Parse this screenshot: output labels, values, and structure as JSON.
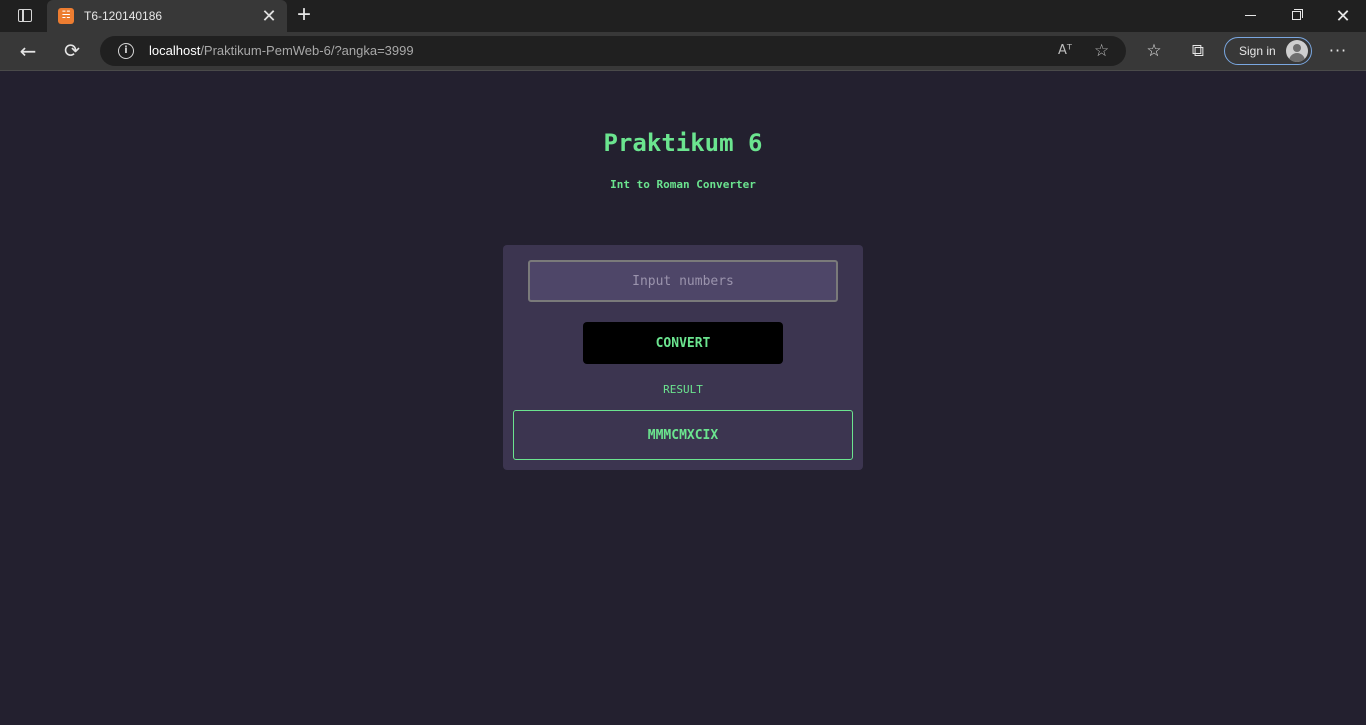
{
  "browser": {
    "tab": {
      "title": "T6-120140186",
      "favicon": "xampp-favicon",
      "favicon_text": "☵"
    },
    "address": {
      "host": "localhost",
      "path": "/Praktikum-PemWeb-6/?angka=3999"
    },
    "signin_label": "Sign in",
    "icons": {
      "tab_actions": "tab-actions-icon",
      "close": "✕",
      "new_tab": "+",
      "back": "←",
      "reload": "⟳",
      "info": "i",
      "read_aloud": "Aᵀ",
      "add_favorite": "☆",
      "favorites": "☆",
      "collections": "⧉",
      "more": "···",
      "window_close": "✕"
    }
  },
  "page": {
    "title": "Praktikum 6",
    "subtitle": "Int to Roman Converter",
    "input": {
      "placeholder": "Input numbers",
      "value": ""
    },
    "convert_label": "CONVERT",
    "result_label": "RESULT",
    "result_value": "MMMCMXCIX"
  },
  "colors": {
    "background": "#23202f",
    "card": "#3c3550",
    "accent": "#6be48f",
    "button": "#000000"
  }
}
